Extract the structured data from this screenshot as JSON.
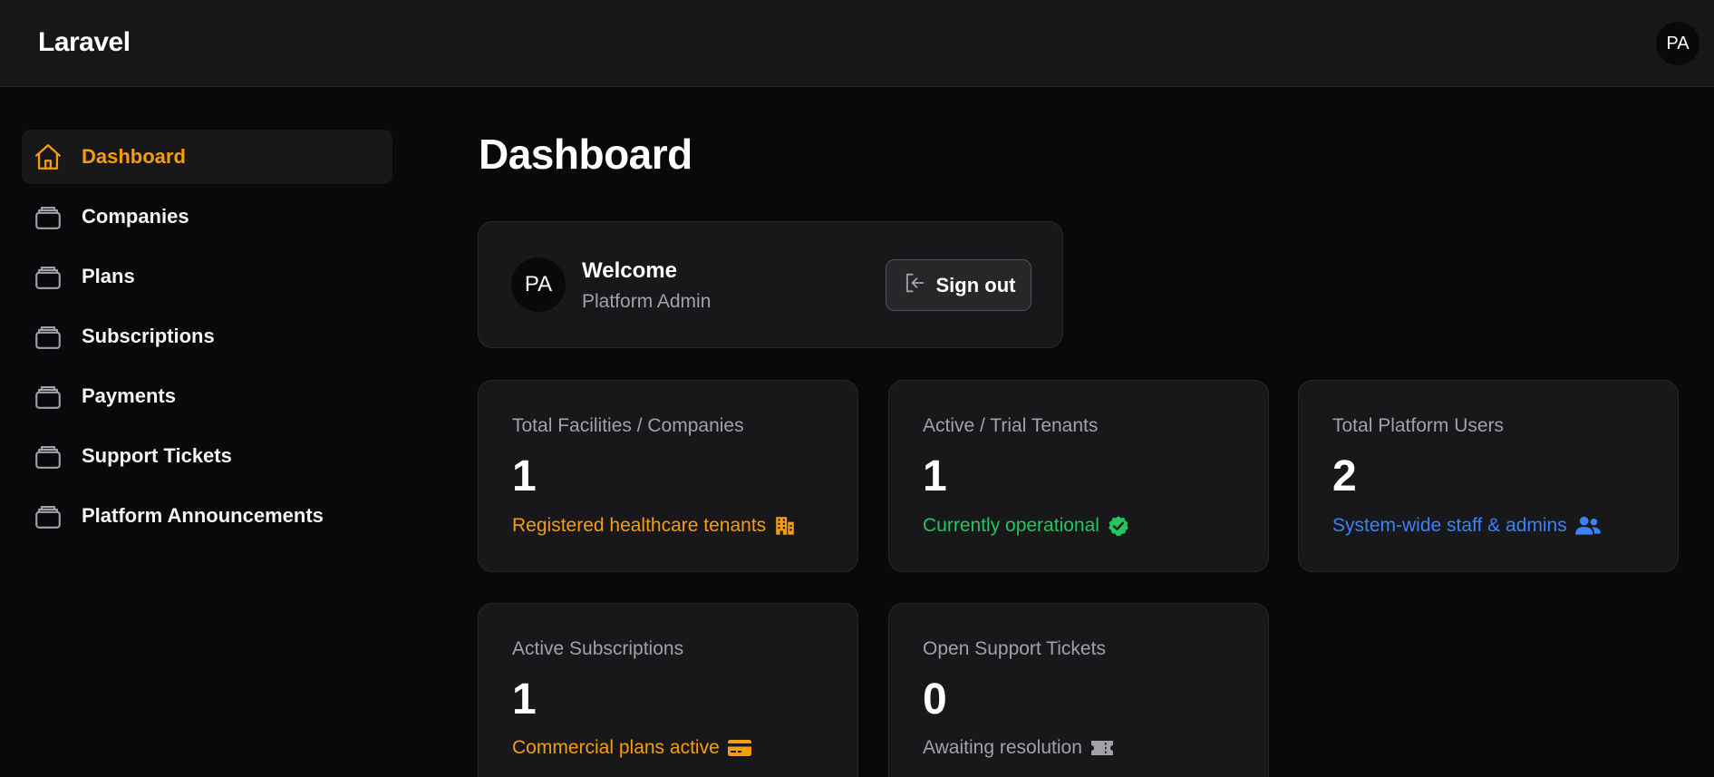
{
  "header": {
    "brand": "Laravel",
    "user_initials": "PA"
  },
  "sidebar": {
    "items": [
      {
        "label": "Dashboard",
        "icon": "home-icon",
        "active": true
      },
      {
        "label": "Companies",
        "icon": "stack-icon"
      },
      {
        "label": "Plans",
        "icon": "stack-icon"
      },
      {
        "label": "Subscriptions",
        "icon": "stack-icon"
      },
      {
        "label": "Payments",
        "icon": "stack-icon"
      },
      {
        "label": "Support Tickets",
        "icon": "stack-icon"
      },
      {
        "label": "Platform Announcements",
        "icon": "stack-icon"
      }
    ]
  },
  "main": {
    "title": "Dashboard",
    "welcome": {
      "initials": "PA",
      "title": "Welcome",
      "subtitle": "Platform Admin",
      "signout_label": "Sign out"
    },
    "stats": [
      {
        "title": "Total Facilities / Companies",
        "value": "1",
        "desc": "Registered healthcare tenants",
        "icon": "building-icon",
        "color": "#f59e0b"
      },
      {
        "title": "Active / Trial Tenants",
        "value": "1",
        "desc": "Currently operational",
        "icon": "check-badge-icon",
        "color": "#22c55e"
      },
      {
        "title": "Total Platform Users",
        "value": "2",
        "desc": "System-wide staff & admins",
        "icon": "users-icon",
        "color": "#3b82f6"
      },
      {
        "title": "Active Subscriptions",
        "value": "1",
        "desc": "Commercial plans active",
        "icon": "credit-card-icon",
        "color": "#f59e0b"
      },
      {
        "title": "Open Support Tickets",
        "value": "0",
        "desc": "Awaiting resolution",
        "icon": "ticket-icon",
        "color": "#a1a1aa"
      }
    ]
  },
  "colors": {
    "accent": "#f59e0b",
    "background": "#09090b",
    "surface": "#18181b",
    "border": "#27272a"
  }
}
